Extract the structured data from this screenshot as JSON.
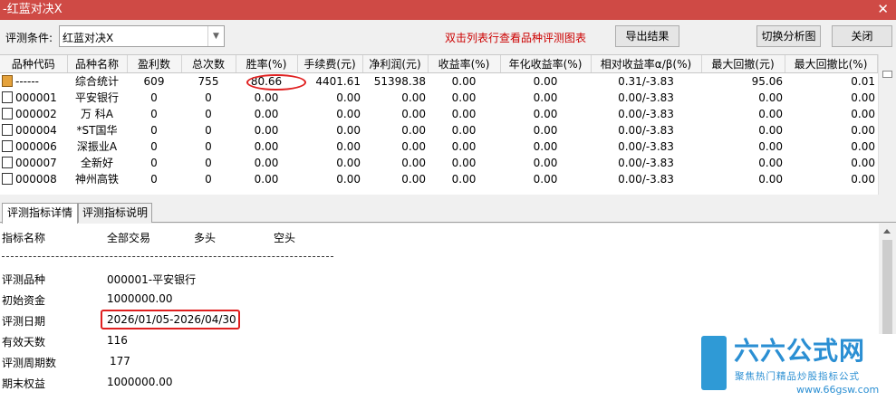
{
  "window": {
    "title": "-红蓝对决X",
    "close_glyph": "✕"
  },
  "toolbar": {
    "condition_label": "评测条件:",
    "condition_value": "红蓝对决X",
    "hint": "双击列表行查看品种评测图表",
    "export_label": "导出结果",
    "switch_label": "切换分析图",
    "close_label": "关闭"
  },
  "grid": {
    "columns": [
      "品种代码",
      "品种名称",
      "盈利数",
      "总次数",
      "胜率(%)",
      "手续费(元)",
      "净利润(元)",
      "收益率(%)",
      "年化收益率(%)",
      "相对收益率α/β(%)",
      "最大回撤(元)",
      "最大回撤比(%)"
    ],
    "rows": [
      [
        "------",
        "综合统计",
        "609",
        "755",
        "80.66",
        "4401.61",
        "51398.38",
        "0.00",
        "0.00",
        "0.31/-3.83",
        "95.06",
        "0.01"
      ],
      [
        "000001",
        "平安银行",
        "0",
        "0",
        "0.00",
        "0.00",
        "0.00",
        "0.00",
        "0.00",
        "0.00/-3.83",
        "0.00",
        "0.00"
      ],
      [
        "000002",
        "万 科A",
        "0",
        "0",
        "0.00",
        "0.00",
        "0.00",
        "0.00",
        "0.00",
        "0.00/-3.83",
        "0.00",
        "0.00"
      ],
      [
        "000004",
        "*ST国华",
        "0",
        "0",
        "0.00",
        "0.00",
        "0.00",
        "0.00",
        "0.00",
        "0.00/-3.83",
        "0.00",
        "0.00"
      ],
      [
        "000006",
        "深振业A",
        "0",
        "0",
        "0.00",
        "0.00",
        "0.00",
        "0.00",
        "0.00",
        "0.00/-3.83",
        "0.00",
        "0.00"
      ],
      [
        "000007",
        "全新好",
        "0",
        "0",
        "0.00",
        "0.00",
        "0.00",
        "0.00",
        "0.00",
        "0.00/-3.83",
        "0.00",
        "0.00"
      ],
      [
        "000008",
        "神州高铁",
        "0",
        "0",
        "0.00",
        "0.00",
        "0.00",
        "0.00",
        "0.00",
        "0.00/-3.83",
        "0.00",
        "0.00"
      ]
    ]
  },
  "tabs": [
    "评测指标详情",
    "评测指标说明"
  ],
  "details": {
    "header": {
      "name": "指标名称",
      "all": "全部交易",
      "long": "多头",
      "short": "空头"
    },
    "items": [
      {
        "label": "评测品种",
        "value": "000001-平安银行"
      },
      {
        "label": "初始资金",
        "value": "1000000.00"
      },
      {
        "label": "评测日期",
        "value": "2026/01/05-2026/04/30"
      },
      {
        "label": "有效天数",
        "value": "116"
      },
      {
        "label": "评测周期数",
        "value": "177"
      },
      {
        "label": "期末权益",
        "value": "1000000.00"
      }
    ]
  },
  "watermark": {
    "title": "六六公式网",
    "subtitle": "聚焦热门精品炒股指标公式",
    "url": "www.66gsw.com",
    "color": "#2b8fd3"
  },
  "colors": {
    "titlebar": "#cf4a45",
    "hint": "#cc0000",
    "highlight": "#e02020"
  }
}
